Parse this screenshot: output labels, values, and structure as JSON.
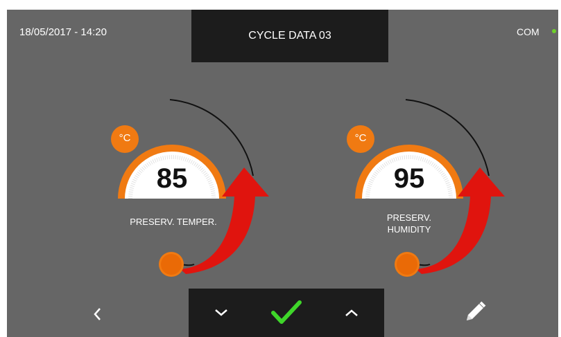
{
  "header": {
    "datetime": "18/05/2017 - 14:20",
    "title": "CYCLE DATA 03",
    "status_label": "COM",
    "status_color": "#6fd12a"
  },
  "gauges": [
    {
      "unit": "°C",
      "value": "85",
      "label_line1": "PRESERV. TEMPER.",
      "label_line2": ""
    },
    {
      "unit": "°C",
      "value": "95",
      "label_line1": "PRESERV.",
      "label_line2": "HUMIDITY"
    }
  ],
  "colors": {
    "accent": "#f07a12",
    "arrow": "#e0140e",
    "confirm": "#3fd62a",
    "panel": "#666666",
    "bar": "#1c1c1c"
  },
  "icons": {
    "back": "chevron-left-icon",
    "down": "chevron-down-icon",
    "confirm": "checkmark-icon",
    "up": "chevron-up-icon",
    "edit": "pencil-icon"
  }
}
